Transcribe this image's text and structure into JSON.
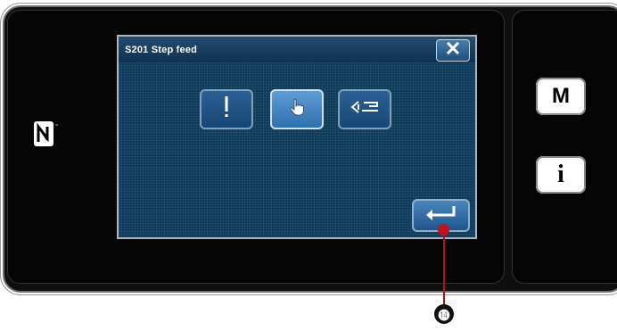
{
  "dialog": {
    "title": "S201 Step feed",
    "close_icon": "close-icon",
    "modes": [
      {
        "icon": "needle-icon",
        "selected": false
      },
      {
        "icon": "hand-pointer-icon",
        "selected": true
      },
      {
        "icon": "presser-foot-icon",
        "selected": false
      }
    ],
    "enter_icon": "enter-icon"
  },
  "side_buttons": {
    "mode_label": "M",
    "info_label": "i"
  },
  "callout": {
    "label": "⓮"
  },
  "colors": {
    "dialog_bg": "#0d3b5a",
    "button_blue": "#1f558b",
    "selected_blue": "#5f9ed6",
    "callout_red": "#c4121c"
  }
}
